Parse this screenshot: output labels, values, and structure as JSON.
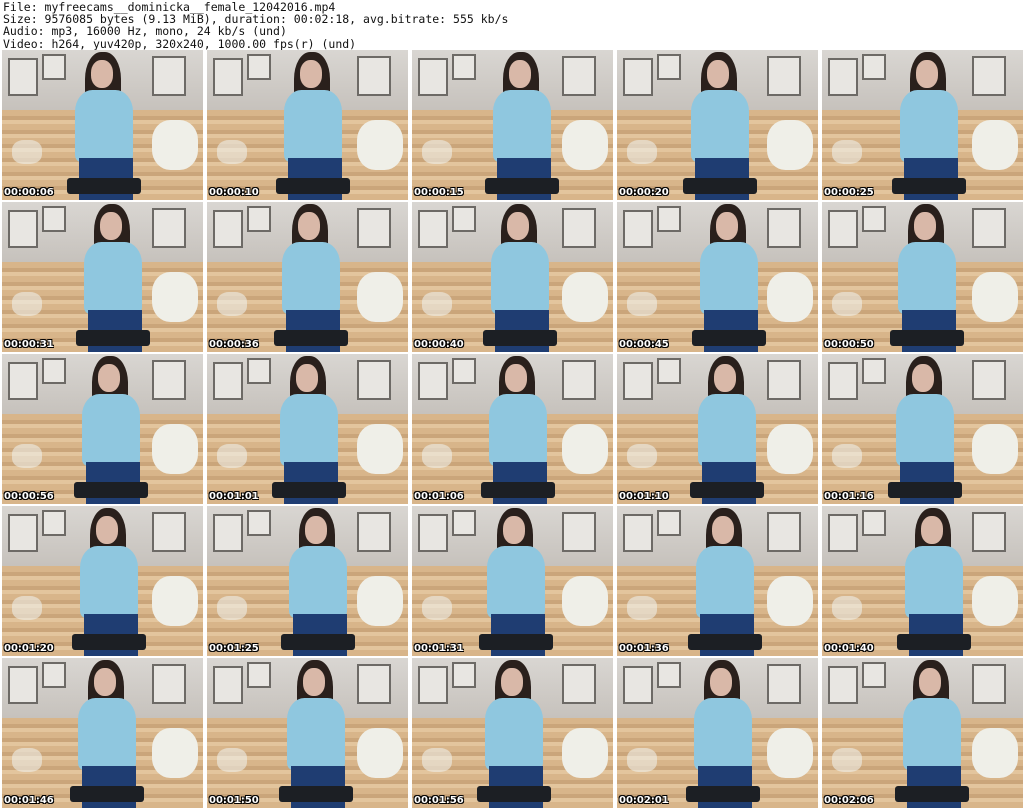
{
  "header": {
    "file": "File: myfreecams__dominicka__female_12042016.mp4",
    "size": "Size: 9576085 bytes (9.13 MiB), duration: 00:02:18, avg.bitrate: 555 kb/s",
    "audio": "Audio: mp3, 16000 Hz, mono, 24 kb/s (und)",
    "video": "Video: h264, yuv420p, 320x240, 1000.00 fps(r) (und)"
  },
  "thumbnails": [
    "00:00:06",
    "00:00:10",
    "00:00:15",
    "00:00:20",
    "00:00:25",
    "00:00:31",
    "00:00:36",
    "00:00:40",
    "00:00:45",
    "00:00:50",
    "00:00:56",
    "00:01:01",
    "00:01:06",
    "00:01:10",
    "00:01:16",
    "00:01:20",
    "00:01:25",
    "00:01:31",
    "00:01:36",
    "00:01:40",
    "00:01:46",
    "00:01:50",
    "00:01:56",
    "00:02:01",
    "00:02:06"
  ],
  "colors": {
    "background": "#ffffff",
    "shirt": "#8fc7df",
    "skirt": "#1f3d72",
    "sofa": "#d8b58a",
    "hair": "#2a201c",
    "timestamp": "#ffffff"
  }
}
